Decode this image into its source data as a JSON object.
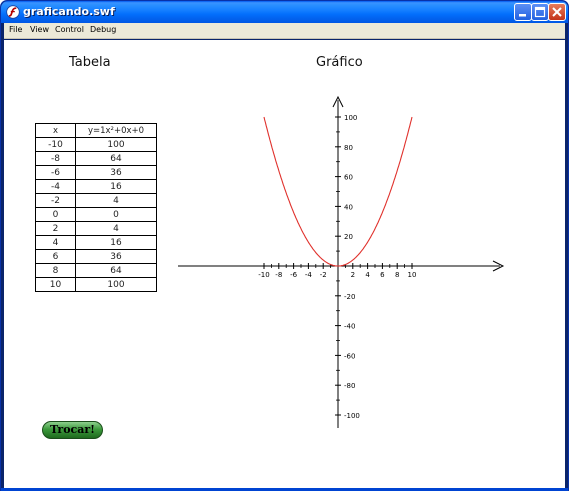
{
  "window": {
    "title": "graficando.swf"
  },
  "menu": [
    "File",
    "View",
    "Control",
    "Debug"
  ],
  "headings": {
    "table": "Tabela",
    "graph": "Gráfico"
  },
  "table": {
    "headers": [
      "x",
      "y=1x²+0x+0"
    ],
    "rows": [
      [
        "-10",
        "100"
      ],
      [
        "-8",
        "64"
      ],
      [
        "-6",
        "36"
      ],
      [
        "-4",
        "16"
      ],
      [
        "-2",
        "4"
      ],
      [
        "0",
        "0"
      ],
      [
        "2",
        "4"
      ],
      [
        "4",
        "16"
      ],
      [
        "6",
        "36"
      ],
      [
        "8",
        "64"
      ],
      [
        "10",
        "100"
      ]
    ]
  },
  "button": {
    "label": "Trocar!"
  },
  "chart_data": {
    "type": "line",
    "series": [
      {
        "function": "y = x^2",
        "color": "#e0312c"
      }
    ],
    "x_ticks": [
      "-10",
      "-8",
      "-6",
      "-4",
      "-2",
      "2",
      "4",
      "6",
      "8",
      "10"
    ],
    "y_ticks": [
      "100",
      "80",
      "60",
      "40",
      "20",
      "-20",
      "-40",
      "-60",
      "-80",
      "-100"
    ],
    "xlim": [
      -10,
      10
    ],
    "ylim": [
      -100,
      100
    ],
    "grid": false
  },
  "colors": {
    "curve": "#e0312c",
    "axes": "#000000",
    "titlebar": "#0058ee"
  }
}
